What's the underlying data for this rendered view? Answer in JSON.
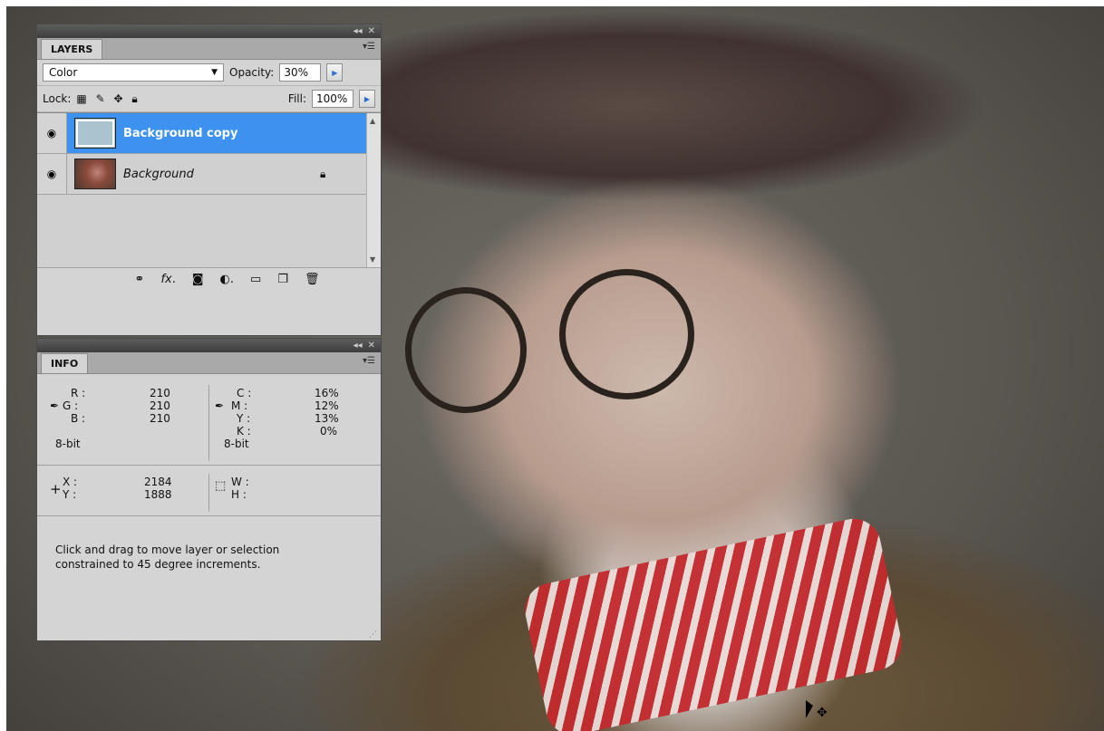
{
  "layers_panel": {
    "tab": "LAYERS",
    "blend_mode": "Color",
    "opacity_label": "Opacity:",
    "opacity_value": "30%",
    "lock_label": "Lock:",
    "fill_label": "Fill:",
    "fill_value": "100%",
    "layers": [
      {
        "name": "Background copy",
        "selected": true,
        "visible": true,
        "locked": false
      },
      {
        "name": "Background",
        "selected": false,
        "visible": true,
        "locked": true
      }
    ]
  },
  "info_panel": {
    "tab": "INFO",
    "rgb": {
      "r_label": "R :",
      "g_label": "G :",
      "b_label": "B :",
      "r": "210",
      "g": "210",
      "b": "210",
      "bit": "8-bit"
    },
    "cmyk": {
      "c_label": "C :",
      "m_label": "M :",
      "y_label": "Y :",
      "k_label": "K :",
      "c": "16%",
      "m": "12%",
      "y": "13%",
      "k": "0%",
      "bit": "8-bit"
    },
    "position": {
      "x_label": "X :",
      "y_label": "Y :",
      "x": "2184",
      "y": "1888"
    },
    "size": {
      "w_label": "W :",
      "h_label": "H :"
    },
    "status_text": "Click and drag to move layer or selection constrained to 45 degree increments."
  },
  "colors": {
    "selection": "#3d92f0",
    "panel_bg": "#d4d4d4",
    "titlebar": "#4a4a4a"
  }
}
